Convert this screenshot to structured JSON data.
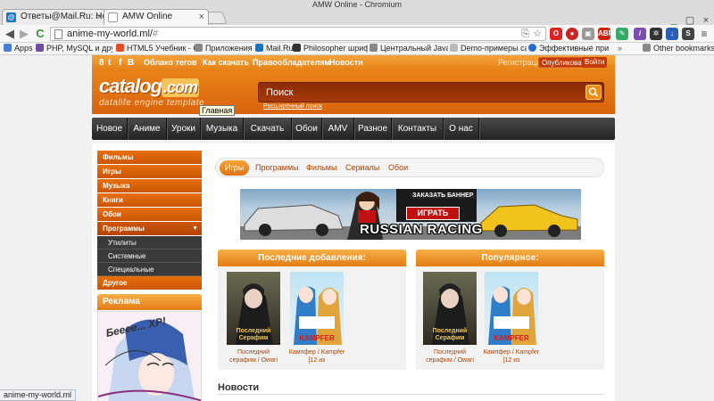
{
  "window": {
    "title": "AMW Online - Chromium"
  },
  "tabs": [
    {
      "label": "Ответы@Mail.Ru: Не о",
      "icon": "mail-icon",
      "active": false
    },
    {
      "label": "AMW Online",
      "icon": "page-icon",
      "active": true
    }
  ],
  "address_bar": {
    "url_main": "anime-my-world.ml/",
    "url_hash": "#"
  },
  "bookmarks": [
    {
      "label": "Apps",
      "icon": "apps-icon",
      "color": "#4a7fd6"
    },
    {
      "label": "PHP, MySQL и друг",
      "icon": "php-icon",
      "color": "#6b4fa0"
    },
    {
      "label": "HTML5 Учебник - С",
      "icon": "html5-icon",
      "color": "#e44d26"
    },
    {
      "label": "Приложения",
      "icon": "folder-icon",
      "color": "#888888"
    },
    {
      "label": "Mail.Ru",
      "icon": "mail-icon",
      "color": "#1e73be"
    },
    {
      "label": "Philosopher шрифт",
      "icon": "font-icon",
      "color": "#333333"
    },
    {
      "label": "Центральный Java",
      "icon": "folder-icon",
      "color": "#888888"
    },
    {
      "label": "Demo-примеры са",
      "icon": "doc-icon",
      "color": "#888888"
    },
    {
      "label": "Эффективные при",
      "icon": "wiki-icon",
      "color": "#2a6ad0"
    }
  ],
  "bookmarks_other": "Other bookmarks",
  "site": {
    "top_links": [
      "Облако тегов",
      "Как скачать",
      "Правообладателям",
      "Новости"
    ],
    "register": "Регистрация",
    "publish": "Опубликовать",
    "login": "Войти",
    "logo_main": "catalog",
    "logo_dot": ".com",
    "logo_sub": "datalife engine template",
    "tooltip": "Главная",
    "search_placeholder": "Поиск",
    "advanced_search": "Расширенный поиск",
    "nav": [
      "Новое",
      "Аниме",
      "Уроки",
      "Музыка",
      "Скачать",
      "Обои",
      "AMV",
      "Разное",
      "Контакты",
      "О нас"
    ],
    "sidebar": [
      "Фильмы",
      "Игры",
      "Музыка",
      "Книги",
      "Обои",
      "Программы"
    ],
    "sidebar_sub": [
      "Утилиты",
      "Системные",
      "Специальные"
    ],
    "sidebar_after": "Другое",
    "ad_title": "Реклама",
    "ad_text": "Бееее... XP!",
    "categories": [
      "Игры",
      "Программы",
      "Фильмы",
      "Сериалы",
      "Обои"
    ],
    "banner": {
      "title": "RUSSIAN RACING",
      "play": "ИГРАТЬ",
      "order": "ЗАКАЗАТЬ БАННЕР"
    },
    "latest_title": "Последние добавления:",
    "popular_title": "Популярное:",
    "latest_items": [
      {
        "title": "Последний серафим / Owari",
        "cover_text": "Последний Серафим"
      },
      {
        "title": "Кампфер / Kampfer [12 из",
        "cover_text": "KAMPFER"
      }
    ],
    "popular_items": [
      {
        "title": "Последний серафим / Owari",
        "cover_text": "Последний Серафим"
      },
      {
        "title": "Кампфер / Kampfer [12 из",
        "cover_text": "KAMPFER"
      }
    ],
    "news_title": "Новости"
  },
  "status_bar": "anime-my-world.ml",
  "colors": {
    "accent": "#e57f14",
    "nav_dark": "#2a2a2a",
    "link": "#b04500"
  }
}
